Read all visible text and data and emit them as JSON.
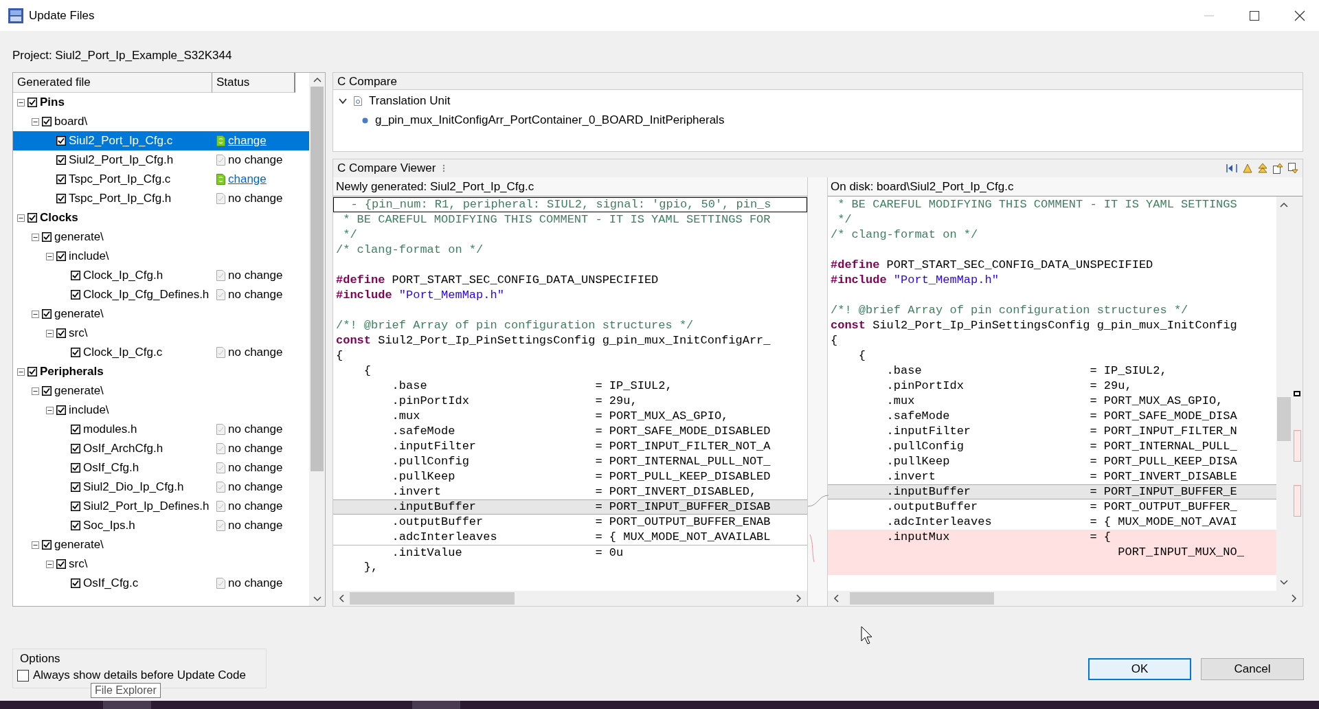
{
  "window": {
    "title": "Update Files"
  },
  "project_label": "Project: Siul2_Port_Ip_Example_S32K344",
  "file_tree": {
    "columns": [
      "Generated file",
      "Status"
    ],
    "items": [
      {
        "kind": "group",
        "label": "Pins",
        "checked": true,
        "expanded": true,
        "selected": false,
        "children": [
          {
            "kind": "folder",
            "label": "board\\",
            "checked": true,
            "expanded": true,
            "selected": false,
            "children": [
              {
                "kind": "file",
                "label": "Siul2_Port_Ip_Cfg.c",
                "checked": true,
                "selected": true,
                "status": {
                  "kind": "change",
                  "text": "change"
                }
              },
              {
                "kind": "file",
                "label": "Siul2_Port_Ip_Cfg.h",
                "checked": true,
                "selected": false,
                "status": {
                  "kind": "no_change",
                  "text": "no change"
                }
              },
              {
                "kind": "file",
                "label": "Tspc_Port_Ip_Cfg.c",
                "checked": true,
                "selected": false,
                "status": {
                  "kind": "change",
                  "text": "change"
                }
              },
              {
                "kind": "file",
                "label": "Tspc_Port_Ip_Cfg.h",
                "checked": true,
                "selected": false,
                "status": {
                  "kind": "no_change",
                  "text": "no change"
                }
              }
            ]
          }
        ]
      },
      {
        "kind": "group",
        "label": "Clocks",
        "checked": true,
        "expanded": true,
        "selected": false,
        "children": [
          {
            "kind": "folder",
            "label": "generate\\",
            "checked": true,
            "expanded": true,
            "selected": false,
            "children": [
              {
                "kind": "folder",
                "label": "include\\",
                "checked": true,
                "expanded": true,
                "selected": false,
                "children": [
                  {
                    "kind": "file",
                    "label": "Clock_Ip_Cfg.h",
                    "checked": true,
                    "selected": false,
                    "status": {
                      "kind": "no_change",
                      "text": "no change"
                    }
                  },
                  {
                    "kind": "file",
                    "label": "Clock_Ip_Cfg_Defines.h",
                    "checked": true,
                    "selected": false,
                    "status": {
                      "kind": "no_change",
                      "text": "no change"
                    }
                  }
                ]
              }
            ]
          },
          {
            "kind": "folder",
            "label": "generate\\",
            "checked": true,
            "expanded": true,
            "selected": false,
            "children": [
              {
                "kind": "folder",
                "label": "src\\",
                "checked": true,
                "expanded": true,
                "selected": false,
                "children": [
                  {
                    "kind": "file",
                    "label": "Clock_Ip_Cfg.c",
                    "checked": true,
                    "selected": false,
                    "status": {
                      "kind": "no_change",
                      "text": "no change"
                    }
                  }
                ]
              }
            ]
          }
        ]
      },
      {
        "kind": "group",
        "label": "Peripherals",
        "checked": true,
        "expanded": true,
        "selected": false,
        "children": [
          {
            "kind": "folder",
            "label": "generate\\",
            "checked": true,
            "expanded": true,
            "selected": false,
            "children": [
              {
                "kind": "folder",
                "label": "include\\",
                "checked": true,
                "expanded": true,
                "selected": false,
                "children": [
                  {
                    "kind": "file",
                    "label": "modules.h",
                    "checked": true,
                    "selected": false,
                    "status": {
                      "kind": "no_change",
                      "text": "no change"
                    }
                  },
                  {
                    "kind": "file",
                    "label": "OsIf_ArchCfg.h",
                    "checked": true,
                    "selected": false,
                    "status": {
                      "kind": "no_change",
                      "text": "no change"
                    }
                  },
                  {
                    "kind": "file",
                    "label": "OsIf_Cfg.h",
                    "checked": true,
                    "selected": false,
                    "status": {
                      "kind": "no_change",
                      "text": "no change"
                    }
                  },
                  {
                    "kind": "file",
                    "label": "Siul2_Dio_Ip_Cfg.h",
                    "checked": true,
                    "selected": false,
                    "status": {
                      "kind": "no_change",
                      "text": "no change"
                    }
                  },
                  {
                    "kind": "file",
                    "label": "Siul2_Port_Ip_Defines.h",
                    "checked": true,
                    "selected": false,
                    "status": {
                      "kind": "no_change",
                      "text": "no change"
                    }
                  },
                  {
                    "kind": "file",
                    "label": "Soc_Ips.h",
                    "checked": true,
                    "selected": false,
                    "status": {
                      "kind": "no_change",
                      "text": "no change"
                    }
                  }
                ]
              }
            ]
          },
          {
            "kind": "folder",
            "label": "generate\\",
            "checked": true,
            "expanded": true,
            "selected": false,
            "children": [
              {
                "kind": "folder",
                "label": "src\\",
                "checked": true,
                "expanded": true,
                "selected": false,
                "children": [
                  {
                    "kind": "file",
                    "label": "OsIf_Cfg.c",
                    "checked": true,
                    "selected": false,
                    "status": {
                      "kind": "no_change",
                      "text": "no change"
                    }
                  }
                ]
              }
            ]
          }
        ]
      }
    ]
  },
  "c_compare": {
    "title": "C Compare",
    "items": [
      {
        "kind": "unit",
        "label": "Translation Unit",
        "expanded": true,
        "children": [
          {
            "kind": "member",
            "label": "g_pin_mux_InitConfigArr_PortContainer_0_BOARD_InitPeripherals"
          }
        ]
      }
    ]
  },
  "compare_viewer": {
    "title": "C Compare Viewer",
    "left": {
      "header": "Newly generated: Siul2_Port_Ip_Cfg.c",
      "lines": [
        {
          "kind": "boxed",
          "spans": [
            {
              "kind": "comment",
              "text": "  - {pin_num: R1, peripheral: SIUL2, signal: 'gpio, 50', pin_s"
            }
          ]
        },
        {
          "kind": "plain",
          "spans": [
            {
              "kind": "comment",
              "text": " * BE CAREFUL MODIFYING THIS COMMENT - IT IS YAML SETTINGS FOR"
            }
          ]
        },
        {
          "kind": "plain",
          "spans": [
            {
              "kind": "comment",
              "text": " */"
            }
          ]
        },
        {
          "kind": "plain",
          "spans": [
            {
              "kind": "comment",
              "text": "/* clang-format on */"
            }
          ]
        },
        {
          "kind": "blank"
        },
        {
          "kind": "plain",
          "spans": [
            {
              "kind": "keyword",
              "text": "#define"
            },
            {
              "kind": "plain",
              "text": " PORT_START_SEC_CONFIG_DATA_UNSPECIFIED"
            }
          ]
        },
        {
          "kind": "plain",
          "spans": [
            {
              "kind": "keyword",
              "text": "#include"
            },
            {
              "kind": "string",
              "text": " \"Port_MemMap.h\""
            }
          ]
        },
        {
          "kind": "blank"
        },
        {
          "kind": "plain",
          "spans": [
            {
              "kind": "comment",
              "text": "/*! @brief Array of pin configuration structures */"
            }
          ]
        },
        {
          "kind": "plain",
          "spans": [
            {
              "kind": "keyword",
              "text": "const"
            },
            {
              "kind": "plain",
              "text": " Siul2_Port_Ip_PinSettingsConfig g_pin_mux_InitConfigArr_"
            }
          ]
        },
        {
          "kind": "plain",
          "spans": [
            {
              "kind": "plain",
              "text": "{"
            }
          ]
        },
        {
          "kind": "plain",
          "spans": [
            {
              "kind": "plain",
              "text": "    {"
            }
          ]
        },
        {
          "kind": "plain",
          "spans": [
            {
              "kind": "plain",
              "text": "        .base                        = IP_SIUL2,"
            }
          ]
        },
        {
          "kind": "plain",
          "spans": [
            {
              "kind": "plain",
              "text": "        .pinPortIdx                  = 29u,"
            }
          ]
        },
        {
          "kind": "plain",
          "spans": [
            {
              "kind": "plain",
              "text": "        .mux                         = PORT_MUX_AS_GPIO,"
            }
          ]
        },
        {
          "kind": "plain",
          "spans": [
            {
              "kind": "plain",
              "text": "        .safeMode                    = PORT_SAFE_MODE_DISABLED"
            }
          ]
        },
        {
          "kind": "plain",
          "spans": [
            {
              "kind": "plain",
              "text": "        .inputFilter                 = PORT_INPUT_FILTER_NOT_A"
            }
          ]
        },
        {
          "kind": "plain",
          "spans": [
            {
              "kind": "plain",
              "text": "        .pullConfig                  = PORT_INTERNAL_PULL_NOT_"
            }
          ]
        },
        {
          "kind": "plain",
          "spans": [
            {
              "kind": "plain",
              "text": "        .pullKeep                    = PORT_PULL_KEEP_DISABLED"
            }
          ]
        },
        {
          "kind": "plain",
          "spans": [
            {
              "kind": "plain",
              "text": "        .invert                      = PORT_INVERT_DISABLED,"
            }
          ]
        },
        {
          "kind": "current",
          "spans": [
            {
              "kind": "plain",
              "text": "        .inputBuffer                 = PORT_INPUT_BUFFER_DISAB"
            }
          ]
        },
        {
          "kind": "plain",
          "spans": [
            {
              "kind": "plain",
              "text": "        .outputBuffer                = PORT_OUTPUT_BUFFER_ENAB"
            }
          ]
        },
        {
          "kind": "plain",
          "spans": [
            {
              "kind": "plain",
              "text": "        .adcInterleaves              = { MUX_MODE_NOT_AVAILABL"
            }
          ]
        },
        {
          "kind": "changed",
          "spans": [
            {
              "kind": "plain",
              "text": "        .initValue                   = 0u"
            }
          ]
        },
        {
          "kind": "plain",
          "spans": [
            {
              "kind": "plain",
              "text": "    },"
            }
          ]
        }
      ]
    },
    "right": {
      "header": "On disk: board\\Siul2_Port_Ip_Cfg.c",
      "lines": [
        {
          "kind": "plain",
          "spans": [
            {
              "kind": "comment",
              "text": " * BE CAREFUL MODIFYING THIS COMMENT - IT IS YAML SETTINGS"
            }
          ]
        },
        {
          "kind": "plain",
          "spans": [
            {
              "kind": "comment",
              "text": " */"
            }
          ]
        },
        {
          "kind": "plain",
          "spans": [
            {
              "kind": "comment",
              "text": "/* clang-format on */"
            }
          ]
        },
        {
          "kind": "blank"
        },
        {
          "kind": "plain",
          "spans": [
            {
              "kind": "keyword",
              "text": "#define"
            },
            {
              "kind": "plain",
              "text": " PORT_START_SEC_CONFIG_DATA_UNSPECIFIED"
            }
          ]
        },
        {
          "kind": "plain",
          "spans": [
            {
              "kind": "keyword",
              "text": "#include"
            },
            {
              "kind": "string",
              "text": " \"Port_MemMap.h\""
            }
          ]
        },
        {
          "kind": "blank"
        },
        {
          "kind": "plain",
          "spans": [
            {
              "kind": "comment",
              "text": "/*! @brief Array of pin configuration structures */"
            }
          ]
        },
        {
          "kind": "plain",
          "spans": [
            {
              "kind": "keyword",
              "text": "const"
            },
            {
              "kind": "plain",
              "text": " Siul2_Port_Ip_PinSettingsConfig g_pin_mux_InitConfig"
            }
          ]
        },
        {
          "kind": "plain",
          "spans": [
            {
              "kind": "plain",
              "text": "{"
            }
          ]
        },
        {
          "kind": "plain",
          "spans": [
            {
              "kind": "plain",
              "text": "    {"
            }
          ]
        },
        {
          "kind": "plain",
          "spans": [
            {
              "kind": "plain",
              "text": "        .base                        = IP_SIUL2,"
            }
          ]
        },
        {
          "kind": "plain",
          "spans": [
            {
              "kind": "plain",
              "text": "        .pinPortIdx                  = 29u,"
            }
          ]
        },
        {
          "kind": "plain",
          "spans": [
            {
              "kind": "plain",
              "text": "        .mux                         = PORT_MUX_AS_GPIO,"
            }
          ]
        },
        {
          "kind": "plain",
          "spans": [
            {
              "kind": "plain",
              "text": "        .safeMode                    = PORT_SAFE_MODE_DISA"
            }
          ]
        },
        {
          "kind": "plain",
          "spans": [
            {
              "kind": "plain",
              "text": "        .inputFilter                 = PORT_INPUT_FILTER_N"
            }
          ]
        },
        {
          "kind": "plain",
          "spans": [
            {
              "kind": "plain",
              "text": "        .pullConfig                  = PORT_INTERNAL_PULL_"
            }
          ]
        },
        {
          "kind": "plain",
          "spans": [
            {
              "kind": "plain",
              "text": "        .pullKeep                    = PORT_PULL_KEEP_DISA"
            }
          ]
        },
        {
          "kind": "plain",
          "spans": [
            {
              "kind": "plain",
              "text": "        .invert                      = PORT_INVERT_DISABLE"
            }
          ]
        },
        {
          "kind": "current",
          "spans": [
            {
              "kind": "plain",
              "text": "        .inputBuffer                 = PORT_INPUT_BUFFER_E"
            }
          ]
        },
        {
          "kind": "plain",
          "spans": [
            {
              "kind": "plain",
              "text": "        .outputBuffer                = PORT_OUTPUT_BUFFER_"
            }
          ]
        },
        {
          "kind": "plain",
          "spans": [
            {
              "kind": "plain",
              "text": "        .adcInterleaves              = { MUX_MODE_NOT_AVAI"
            }
          ]
        },
        {
          "kind": "inserted",
          "spans": [
            {
              "kind": "plain",
              "text": "        .inputMux                    = {"
            }
          ]
        },
        {
          "kind": "inserted",
          "spans": [
            {
              "kind": "plain",
              "text": "                                         PORT_INPUT_MUX_NO_"
            }
          ]
        },
        {
          "kind": "inserted_blank"
        }
      ]
    }
  },
  "options": {
    "title": "Options",
    "checkbox": {
      "label": "Always show details before Update Code",
      "checked": false
    }
  },
  "tooltip": "File Explorer",
  "buttons": [
    {
      "label": "OK",
      "default": true
    },
    {
      "label": "Cancel",
      "default": false
    }
  ]
}
